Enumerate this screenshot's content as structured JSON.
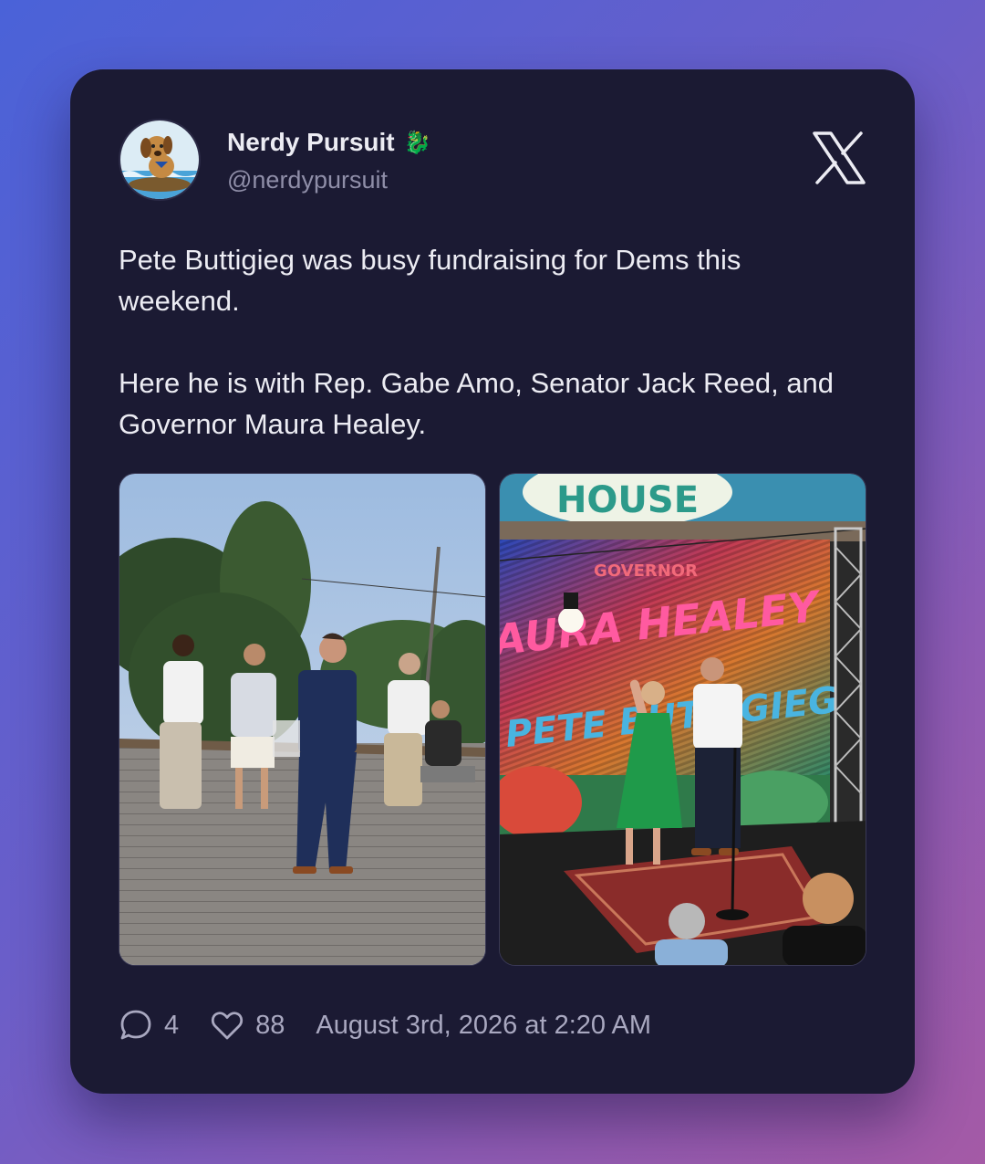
{
  "author": {
    "display_name": "Nerdy Pursuit",
    "badge_emoji": "🐉",
    "handle": "@nerdypursuit"
  },
  "platform_logo": "x-logo-icon",
  "tweet": {
    "paragraph_1": "Pete Buttigieg was busy fundraising for Dems this weekend.",
    "paragraph_2": "Here he is with Rep. Gabe Amo, Senator Jack Reed, and Governor Maura Healey."
  },
  "media": [
    {
      "kind": "photo",
      "content": "outdoor-deck-gathering"
    },
    {
      "kind": "photo",
      "content": "stage-with-led-screen"
    }
  ],
  "media_text": {
    "banner": "HOUSE",
    "screen_line_1": "GOVERNOR",
    "screen_line_2": "MAURA HEALEY",
    "screen_line_3": "PETE BUTTIGIEG"
  },
  "footer": {
    "replies_icon": "comment-bubble-icon",
    "replies": "4",
    "likes_icon": "heart-icon",
    "likes": "88",
    "timestamp": "August 3rd, 2026 at 2:20 AM"
  },
  "colors": {
    "card_bg": "#1b1a33",
    "text_primary": "#ececf3",
    "text_secondary": "#8f8ea8"
  }
}
